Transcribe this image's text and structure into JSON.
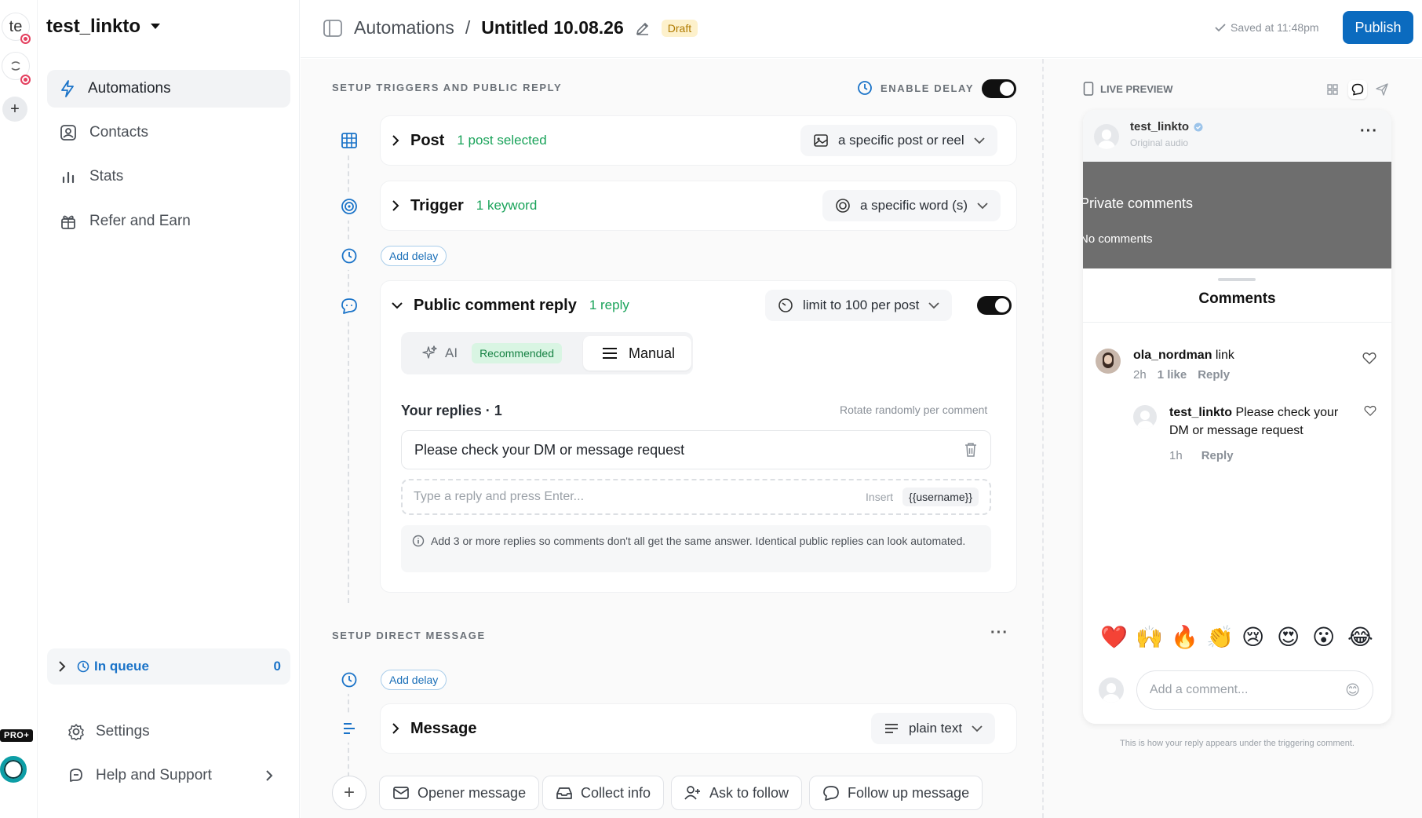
{
  "accounts": {
    "initials": "te"
  },
  "rail": {
    "pro_badge": "PRO+"
  },
  "workspace": {
    "name": "test_linkto"
  },
  "sidebar": {
    "items": [
      {
        "label": "Automations",
        "icon": "lightning-icon"
      },
      {
        "label": "Contacts",
        "icon": "contact-icon"
      },
      {
        "label": "Stats",
        "icon": "bar-chart-icon"
      },
      {
        "label": "Refer and Earn",
        "icon": "gift-icon"
      }
    ],
    "queue": {
      "label": "In queue",
      "count": "0"
    },
    "footer": [
      {
        "label": "Settings",
        "icon": "gear-icon"
      },
      {
        "label": "Help and Support",
        "icon": "help-icon"
      }
    ]
  },
  "header": {
    "breadcrumb_root": "Automations",
    "separator": "/",
    "title": "Untitled 10.08.26",
    "status": "Draft",
    "saved": "Saved at 11:48pm",
    "publish": "Publish"
  },
  "triggers": {
    "section_title": "SETUP TRIGGERS AND PUBLIC REPLY",
    "enable_delay": "ENABLE DELAY",
    "post": {
      "name": "Post",
      "meta": "1 post selected",
      "select": "a specific post or reel"
    },
    "trigger": {
      "name": "Trigger",
      "meta": "1 keyword",
      "select": "a specific word (s)"
    },
    "add_delay": "Add delay",
    "public_reply": {
      "name": "Public comment reply",
      "meta": "1 reply",
      "select": "limit to 100 per post",
      "mode_ai": "AI",
      "mode_ai_badge": "Recommended",
      "mode_manual": "Manual",
      "replies_title": "Your replies · 1",
      "rotate_note": "Rotate randomly per comment",
      "reply_1": "Please check your DM or message request",
      "input_placeholder": "Type a reply and press Enter...",
      "insert_label": "Insert",
      "insert_token": "{{username}}",
      "info": "Add 3 or more replies so comments don't all get the same answer. Identical public replies can look automated."
    }
  },
  "direct_message": {
    "section_title": "SETUP DIRECT MESSAGE",
    "more": "···",
    "add_delay": "Add delay",
    "message": {
      "name": "Message",
      "select": "plain text"
    },
    "chips": [
      "Opener message",
      "Collect info",
      "Ask to follow",
      "Follow up message"
    ]
  },
  "preview": {
    "title": "LIVE PREVIEW",
    "account": "test_linkto",
    "audio": "Original audio",
    "overlay_title": "Private comments",
    "overlay_sub": "No comments",
    "sheet_title": "Comments",
    "comments": [
      {
        "user": "ola_nordman",
        "text": "link",
        "time": "2h",
        "likes": "1 like",
        "reply": "Reply"
      },
      {
        "user": "test_linkto",
        "text": "Please check your DM or message request",
        "time": "1h",
        "reply": "Reply"
      }
    ],
    "emojis": [
      "❤️",
      "🙌",
      "🔥",
      "👏",
      "😢",
      "😍",
      "😮",
      "😂"
    ],
    "add_comment": "Add a comment...",
    "caption": "This is how your reply appears under the triggering comment."
  }
}
